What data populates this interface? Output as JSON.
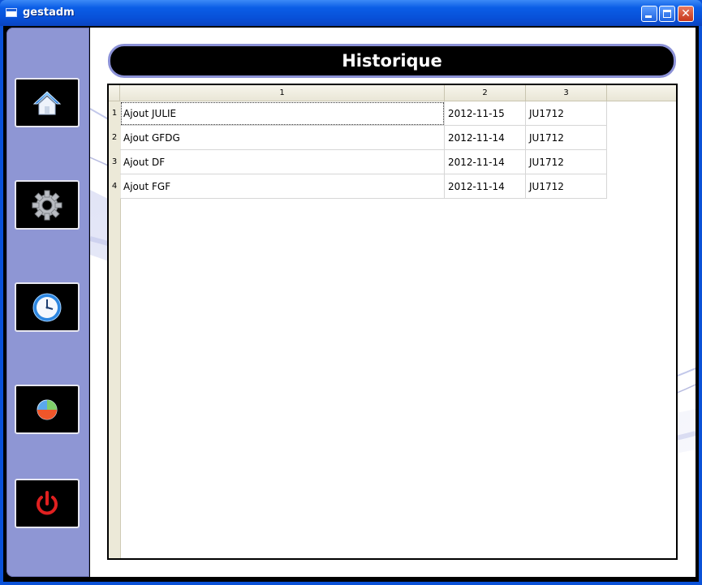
{
  "window": {
    "title": "gestadm",
    "minimize_label": "",
    "maximize_label": "",
    "close_label": "✕"
  },
  "sidebar": {
    "items": [
      {
        "name": "home",
        "icon": "home-icon"
      },
      {
        "name": "settings",
        "icon": "gear-icon"
      },
      {
        "name": "history",
        "icon": "clock-icon"
      },
      {
        "name": "stats",
        "icon": "pie-chart-icon"
      },
      {
        "name": "quit",
        "icon": "power-icon"
      }
    ]
  },
  "header": {
    "title": "Historique"
  },
  "table": {
    "columns": [
      "1",
      "2",
      "3"
    ],
    "rows": [
      {
        "num": "1",
        "cells": [
          "Ajout JULIE",
          "2012-11-15",
          "JU1712"
        ]
      },
      {
        "num": "2",
        "cells": [
          "Ajout GFDG",
          "2012-11-14",
          "JU1712"
        ]
      },
      {
        "num": "3",
        "cells": [
          "Ajout DF",
          "2012-11-14",
          "JU1712"
        ]
      },
      {
        "num": "4",
        "cells": [
          "Ajout FGF",
          "2012-11-14",
          "JU1712"
        ]
      }
    ]
  },
  "colors": {
    "sidebar": "#8e96d4",
    "header_border": "#8b91d6",
    "titlebar": "#0a5de6",
    "power_red": "#e02020"
  }
}
